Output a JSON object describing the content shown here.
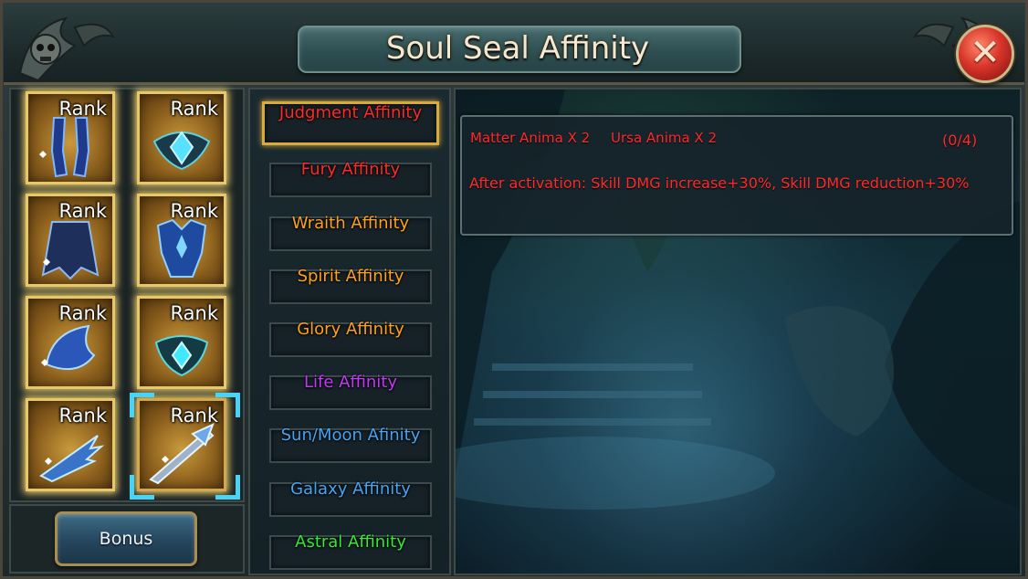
{
  "window": {
    "title": "Soul Seal Affinity",
    "close_icon": "close-x-icon"
  },
  "items": [
    {
      "rank_label": "Rank",
      "icon": "leg-armor-icon",
      "selected": false
    },
    {
      "rank_label": "Rank",
      "icon": "crystal-amulet-icon",
      "selected": false
    },
    {
      "rank_label": "Rank",
      "icon": "cloak-armor-icon",
      "selected": false
    },
    {
      "rank_label": "Rank",
      "icon": "chest-armor-icon",
      "selected": false
    },
    {
      "rank_label": "Rank",
      "icon": "shoulder-guard-icon",
      "selected": false
    },
    {
      "rank_label": "Rank",
      "icon": "gem-pendant-icon",
      "selected": false
    },
    {
      "rank_label": "Rank",
      "icon": "claw-weapon-icon",
      "selected": false
    },
    {
      "rank_label": "Rank",
      "icon": "spear-weapon-icon",
      "selected": true
    }
  ],
  "bonus_label": "Bonus",
  "affinities": [
    {
      "label": "Judgment Affinity",
      "color": "#ff2a2a",
      "active": true
    },
    {
      "label": "Fury Affinity",
      "color": "#ff2a2a",
      "active": false
    },
    {
      "label": "Wraith Affinity",
      "color": "#ffa11c",
      "active": false
    },
    {
      "label": "Spirit Affinity",
      "color": "#ffa11c",
      "active": false
    },
    {
      "label": "Glory Affinity",
      "color": "#ffa11c",
      "active": false
    },
    {
      "label": "Life Affinity",
      "color": "#c03cf0",
      "active": false
    },
    {
      "label": "Sun/Moon Afinity",
      "color": "#4aa3f0",
      "active": false
    },
    {
      "label": "Galaxy Affinity",
      "color": "#4aa3f0",
      "active": false
    },
    {
      "label": "Astral Affinity",
      "color": "#35e83a",
      "active": false
    }
  ],
  "detail": {
    "requirement_1": "Matter Anima X 2",
    "requirement_2": "Ursa Anima X 2",
    "progress": "(0/4)",
    "effect": "After activation: Skill DMG increase+30%, Skill DMG reduction+30%",
    "text_color": "#ff2a2a"
  }
}
